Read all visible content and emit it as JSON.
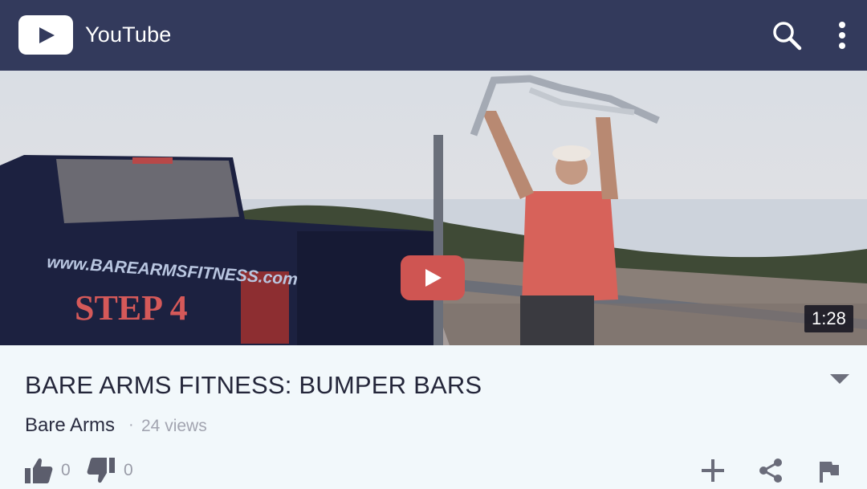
{
  "app": {
    "title": "YouTube",
    "logo_icon": "youtube-play-logo-icon",
    "bar_color": "#333a5c"
  },
  "header": {
    "search_icon": "search-icon",
    "more_icon": "more-vertical-icon"
  },
  "player": {
    "play_icon": "play-icon",
    "play_color": "#cf5552",
    "duration": "1:28",
    "scene_text": {
      "truck_url": "www.BAREARMSFITNESS.com",
      "truck_step": "STEP 4"
    }
  },
  "video": {
    "title": "BARE ARMS FITNESS: BUMPER BARS",
    "channel": "Bare Arms",
    "separator": "·",
    "views": "24 views",
    "expand_icon": "chevron-down-icon"
  },
  "actions": {
    "likes": "0",
    "dislikes": "0",
    "like_icon": "thumbs-up-icon",
    "dislike_icon": "thumbs-down-icon",
    "add_icon": "add-to-playlist-icon",
    "share_icon": "share-icon",
    "flag_icon": "flag-icon"
  }
}
